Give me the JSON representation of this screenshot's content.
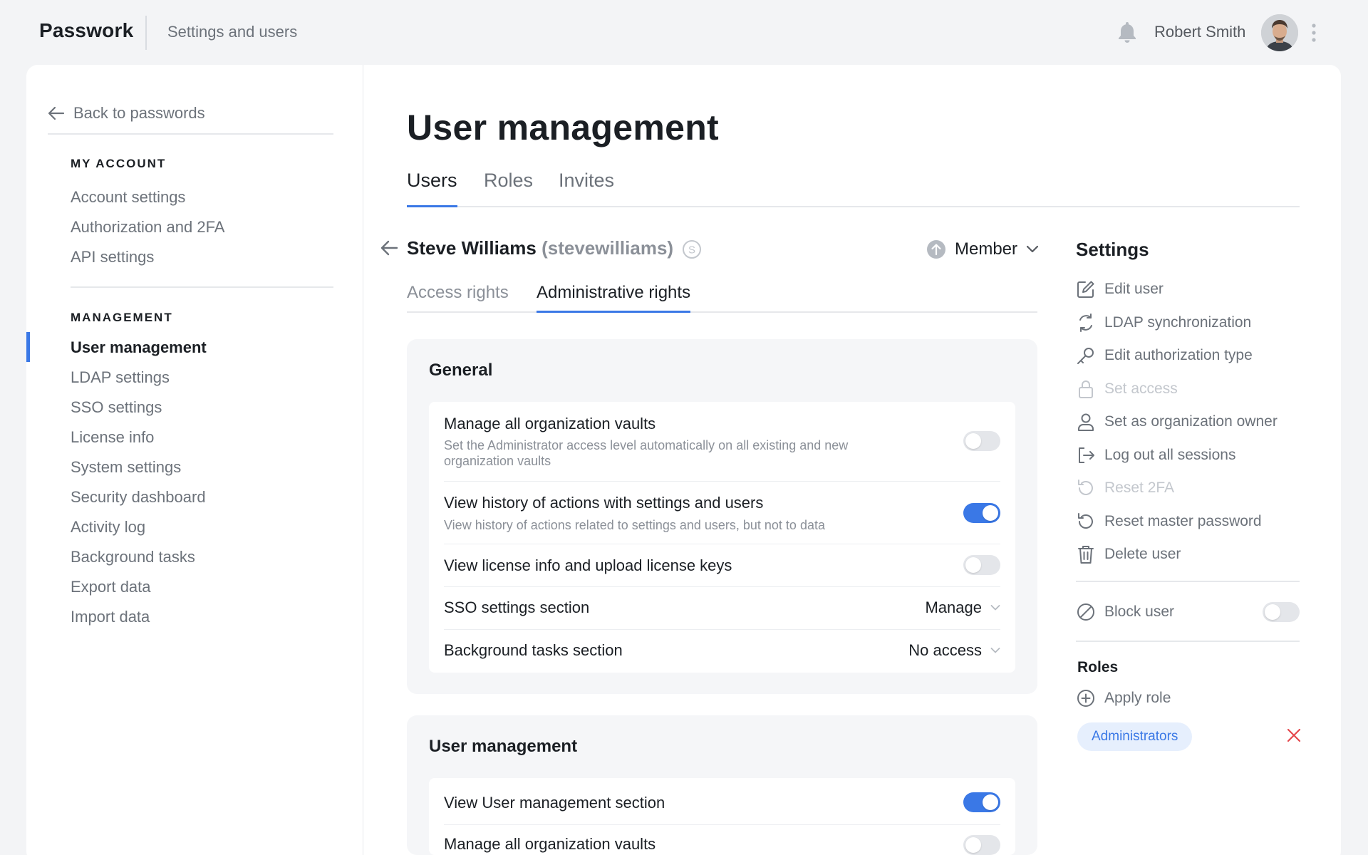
{
  "header": {
    "logo": "Passwork",
    "section": "Settings and users",
    "user_name": "Robert Smith"
  },
  "sidebar": {
    "back_label": "Back to passwords",
    "my_account_heading": "MY ACCOUNT",
    "my_account_items": [
      {
        "label": "Account settings"
      },
      {
        "label": "Authorization and 2FA"
      },
      {
        "label": "API settings"
      }
    ],
    "management_heading": "MANAGEMENT",
    "management_items": [
      {
        "label": "User management",
        "active": true
      },
      {
        "label": "LDAP settings"
      },
      {
        "label": "SSO settings"
      },
      {
        "label": "License info"
      },
      {
        "label": "System settings"
      },
      {
        "label": "Security dashboard"
      },
      {
        "label": "Activity log"
      },
      {
        "label": "Background tasks"
      },
      {
        "label": "Export data"
      },
      {
        "label": "Import data"
      }
    ]
  },
  "main": {
    "title": "User management",
    "tabs": [
      {
        "label": "Users",
        "active": true
      },
      {
        "label": "Roles"
      },
      {
        "label": "Invites"
      }
    ],
    "user": {
      "name": "Steve Williams",
      "login": "(stevewilliams)",
      "badge": "S",
      "role": "Member"
    },
    "subtabs": [
      {
        "label": "Access rights"
      },
      {
        "label": "Administrative rights",
        "active": true
      }
    ],
    "general": {
      "title": "General",
      "rows": [
        {
          "title": "Manage all organization vaults",
          "desc": "Set the Administrator access level automatically on all existing and new organization vaults",
          "toggle": false
        },
        {
          "title": "View history of actions with settings and users",
          "desc": "View history of actions related to settings and users, but not to data",
          "toggle": true
        },
        {
          "title": "View license info and upload license keys",
          "toggle": false
        },
        {
          "title": "SSO settings section",
          "select": "Manage"
        },
        {
          "title": "Background tasks section",
          "select": "No access"
        }
      ]
    },
    "user_management": {
      "title": "User management",
      "rows": [
        {
          "title": "View User management section",
          "toggle": true
        },
        {
          "title": "Manage all organization vaults",
          "toggle": false
        }
      ]
    }
  },
  "settings": {
    "title": "Settings",
    "items": [
      {
        "label": "Edit user",
        "icon": "edit-icon"
      },
      {
        "label": "LDAP synchronization",
        "icon": "sync-icon"
      },
      {
        "label": "Edit authorization type",
        "icon": "key-icon"
      },
      {
        "label": "Set access",
        "icon": "lock-icon",
        "disabled": true
      },
      {
        "label": "Set as organization owner",
        "icon": "person-icon"
      },
      {
        "label": "Log out all sessions",
        "icon": "logout-icon"
      },
      {
        "label": "Reset 2FA",
        "icon": "reset-icon",
        "disabled": true
      },
      {
        "label": "Reset master password",
        "icon": "reset-icon"
      },
      {
        "label": "Delete user",
        "icon": "trash-icon"
      }
    ],
    "block_user": {
      "label": "Block user",
      "enabled": false
    },
    "roles_title": "Roles",
    "apply_role": "Apply role",
    "assigned_roles": [
      "Administrators"
    ]
  },
  "colors": {
    "accent": "#3a78e6",
    "remove": "#e5484d",
    "muted_text": "#6c727a"
  }
}
